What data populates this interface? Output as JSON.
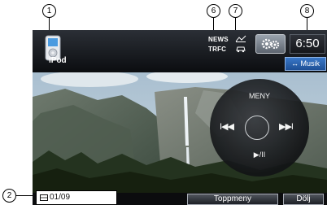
{
  "callouts": {
    "c1": "1",
    "c2": "2",
    "c6": "6",
    "c7": "7",
    "c8": "8"
  },
  "header": {
    "source_label": "iPod",
    "news_label": "NEWS",
    "trfc_label": "TRFC",
    "clock": "6:50",
    "musik_label": "↔ Musik"
  },
  "control_pad": {
    "menu_label": "MENY",
    "prev_glyph": "I◀◀",
    "next_glyph": "▶▶I",
    "play_pause_glyph": "▶/II"
  },
  "footer": {
    "chapter": "01/09",
    "top_menu_label": "Toppmeny",
    "hide_label": "Dölj"
  },
  "colors": {
    "accent_blue": "#2a63b0",
    "bar_dark": "#0b0d10"
  }
}
